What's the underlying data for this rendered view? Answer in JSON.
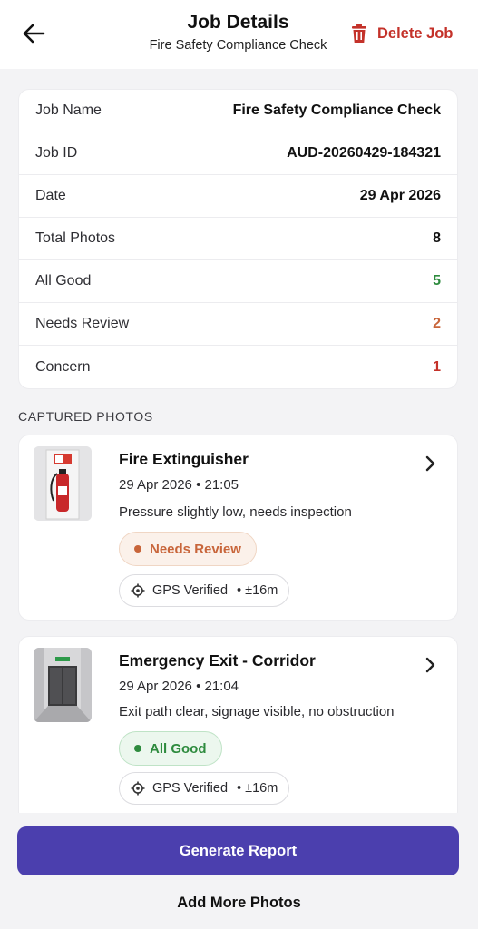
{
  "header": {
    "title": "Job Details",
    "subtitle": "Fire Safety Compliance Check",
    "delete_label": "Delete Job",
    "back_icon": "arrow-left-icon",
    "delete_icon": "trash-icon",
    "accent_color": "#c4322a"
  },
  "summary": {
    "rows": [
      {
        "label": "Job Name",
        "value": "Fire Safety Compliance Check"
      },
      {
        "label": "Job ID",
        "value": "AUD-20260429-184321"
      },
      {
        "label": "Date",
        "value": "29 Apr 2026"
      },
      {
        "label": "Total Photos",
        "value": "8"
      },
      {
        "label": "All Good",
        "value": "5"
      },
      {
        "label": "Needs Review",
        "value": "2"
      },
      {
        "label": "Concern",
        "value": "1"
      }
    ],
    "status_colors": {
      "good": "#2e8b3e",
      "review": "#c8653a",
      "concern": "#c4322a"
    }
  },
  "photos_section": {
    "label": "CAPTURED PHOTOS",
    "items": [
      {
        "title": "Fire Extinguisher",
        "meta": "29 Apr 2026 • 21:05",
        "note": "Pressure slightly low, needs inspection",
        "status": "Needs Review",
        "gps_label": "GPS Verified",
        "gps_accuracy": "• ±16m"
      },
      {
        "title": "Emergency Exit - Corridor",
        "meta": "29 Apr 2026 • 21:04",
        "note": "Exit path clear, signage visible, no obstruction",
        "status": "All Good",
        "gps_label": "GPS Verified",
        "gps_accuracy": "• ±16m"
      }
    ]
  },
  "footer": {
    "generate_label": "Generate Report",
    "add_more_label": "Add More Photos",
    "primary_color": "#4b3fae"
  }
}
